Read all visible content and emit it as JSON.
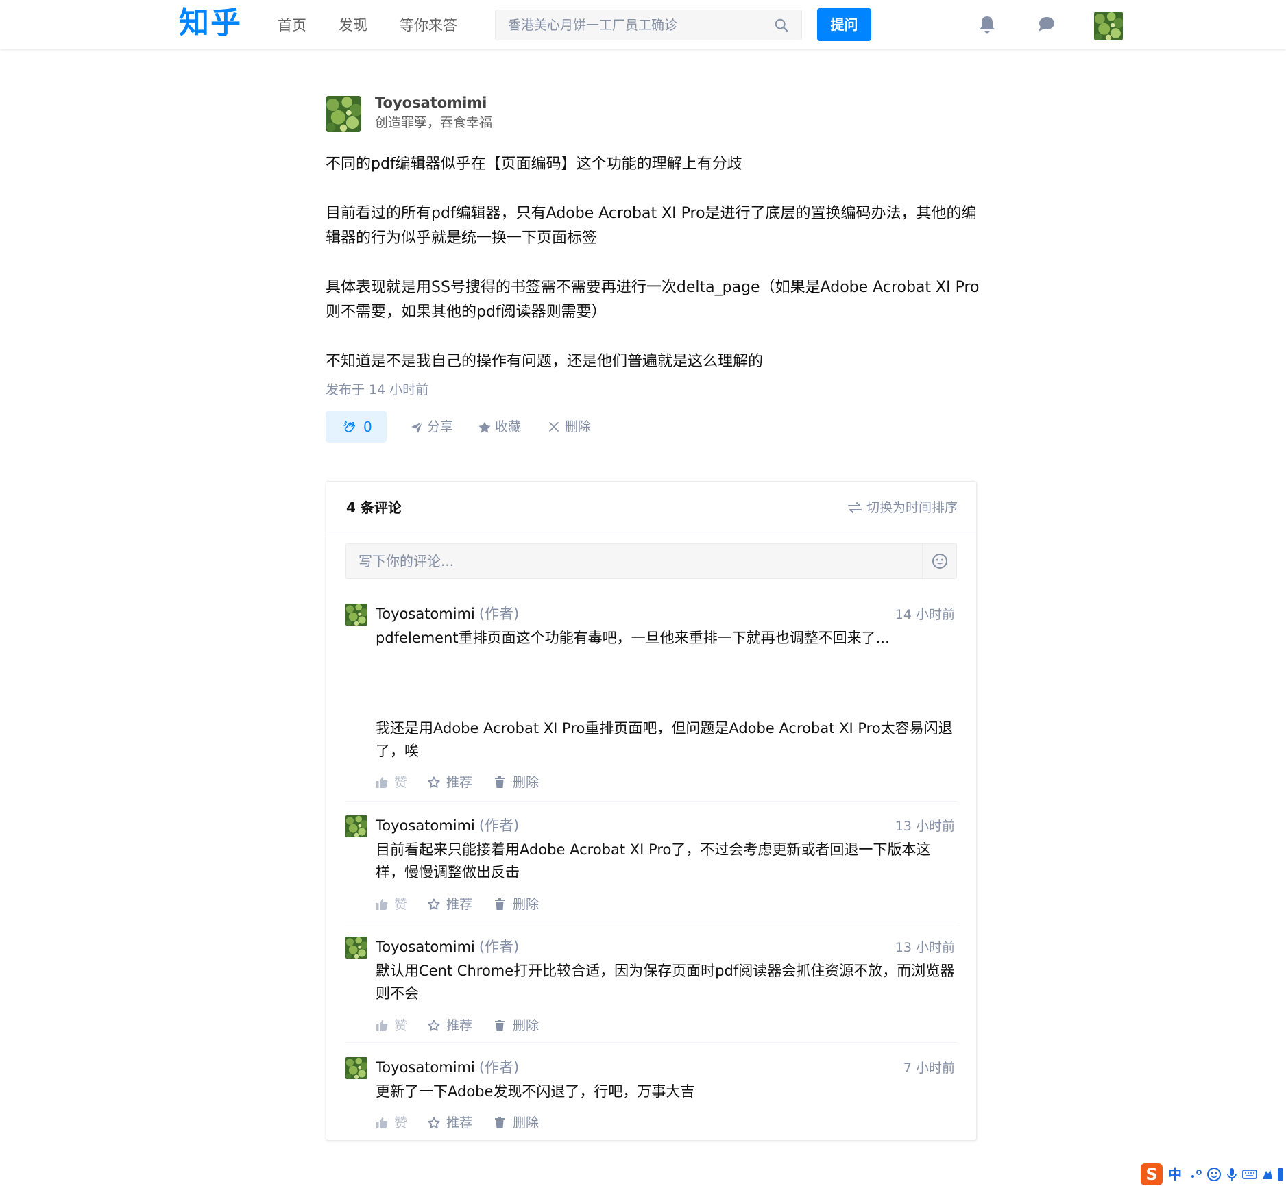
{
  "header": {
    "logo": "知乎",
    "nav": [
      "首页",
      "发现",
      "等你来答"
    ],
    "search_placeholder": "香港美心月饼一工厂员工确诊",
    "ask_label": "提问"
  },
  "post": {
    "author": "Toyosatomimi",
    "bio": "创造罪孽，吞食幸福",
    "paragraphs": [
      "不同的pdf编辑器似乎在【页面编码】这个功能的理解上有分歧",
      "目前看过的所有pdf编辑器，只有Adobe Acrobat XI Pro是进行了底层的置换编码办法，其他的编辑器的行为似乎就是统一换一下页面标签",
      "具体表现就是用SS号搜得的书签需不需要再进行一次delta_page（如果是Adobe Acrobat XI Pro则不需要，如果其他的pdf阅读器则需要）",
      "不知道是不是我自己的操作有问题，还是他们普遍就是这么理解的"
    ],
    "time": "发布于 14 小时前",
    "clap_count": "0",
    "actions": {
      "share": "分享",
      "collect": "收藏",
      "delete": "删除"
    }
  },
  "comments_section": {
    "count_label": "4 条评论",
    "sort_label": "切换为时间排序",
    "input_placeholder": "写下你的评论...",
    "action_labels": {
      "like": "赞",
      "recommend": "推荐",
      "delete": "删除"
    },
    "items": [
      {
        "author": "Toyosatomimi",
        "role": "(作者)",
        "time": "14 小时前",
        "text_1": "pdfelement重排页面这个功能有毒吧，一旦他来重排一下就再也调整不回来了...",
        "text_2": "我还是用Adobe Acrobat XI Pro重排页面吧，但问题是Adobe Acrobat XI Pro太容易闪退了，唉"
      },
      {
        "author": "Toyosatomimi",
        "role": "(作者)",
        "time": "13 小时前",
        "text_1": "目前看起来只能接着用Adobe Acrobat XI Pro了，不过会考虑更新或者回退一下版本这样，慢慢调整做出反击"
      },
      {
        "author": "Toyosatomimi",
        "role": "(作者)",
        "time": "13 小时前",
        "text_1": "默认用Cent Chrome打开比较合适，因为保存页面时pdf阅读器会抓住资源不放，而浏览器则不会"
      },
      {
        "author": "Toyosatomimi",
        "role": "(作者)",
        "time": "7 小时前",
        "text_1": "更新了一下Adobe发现不闪退了，行吧，万事大吉"
      }
    ]
  },
  "ime": {
    "logo": "S",
    "mode": "中"
  },
  "colors": {
    "brand": "#0084ff",
    "muted": "#8590a6",
    "text": "#121212",
    "ime": "#f25c19"
  }
}
